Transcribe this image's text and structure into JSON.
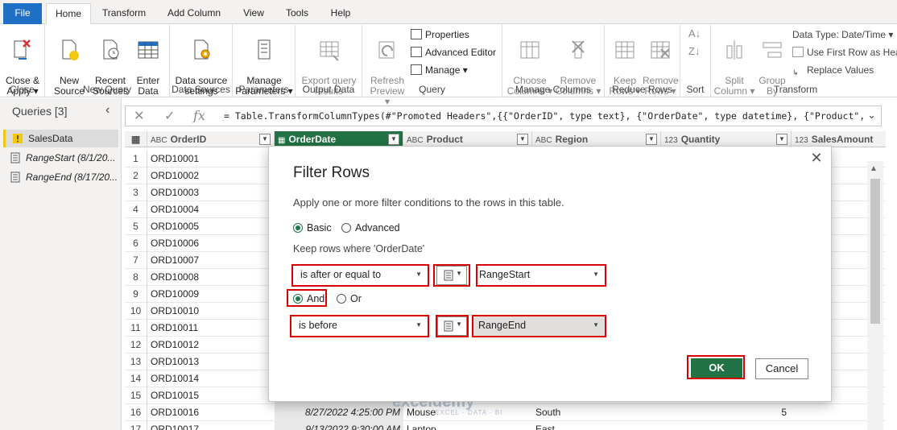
{
  "tabs": [
    "File",
    "Home",
    "Transform",
    "Add Column",
    "View",
    "Tools",
    "Help"
  ],
  "ribbon": {
    "close": {
      "btn": "Close &\nApply ▾",
      "label": "Close"
    },
    "new_query": {
      "new_source": "New\nSource ▾",
      "recent_sources": "Recent\nSources ▾",
      "enter_data": "Enter\nData",
      "label": "New Query"
    },
    "data_sources": {
      "btn": "Data source\nsettings",
      "label": "Data Sources"
    },
    "parameters": {
      "btn": "Manage\nParameters ▾",
      "label": "Parameters"
    },
    "output_data": {
      "btn": "Export query\nresults",
      "label": "Output Data"
    },
    "query": {
      "refresh": "Refresh\nPreview ▾",
      "properties": "Properties",
      "advanced_editor": "Advanced Editor",
      "manage": "Manage ▾",
      "label": "Query"
    },
    "manage_columns": {
      "choose": "Choose\nColumns ▾",
      "remove": "Remove\nColumns ▾",
      "label": "Manage Columns"
    },
    "reduce_rows": {
      "keep": "Keep\nRows ▾",
      "remove": "Remove\nRows ▾",
      "label": "Reduce Rows"
    },
    "sort": {
      "label": "Sort"
    },
    "transform": {
      "split": "Split\nColumn ▾",
      "group": "Group\nBy",
      "data_type": "Data Type: Date/Time ▾",
      "use_first_row": "Use First Row as Headers ▾",
      "replace_values": "Replace Values",
      "label": "Transform"
    }
  },
  "queries": {
    "header": "Queries [3]",
    "items": [
      {
        "name": "SalesData"
      },
      {
        "name": "RangeStart (8/1/20..."
      },
      {
        "name": "RangeEnd (8/17/20..."
      }
    ]
  },
  "formula": "= Table.TransformColumnTypes(#\"Promoted Headers\",{{\"OrderID\", type text}, {\"OrderDate\", type datetime}, {\"Product\",",
  "grid": {
    "columns": [
      {
        "type": "ABC",
        "name": "OrderID"
      },
      {
        "type": "▦",
        "name": "OrderDate"
      },
      {
        "type": "ABC",
        "name": "Product"
      },
      {
        "type": "ABC",
        "name": "Region"
      },
      {
        "type": "123",
        "name": "Quantity"
      },
      {
        "type": "123",
        "name": "SalesAmount"
      }
    ],
    "rows": [
      {
        "n": "1",
        "id": "ORD10001"
      },
      {
        "n": "2",
        "id": "ORD10002"
      },
      {
        "n": "3",
        "id": "ORD10003"
      },
      {
        "n": "4",
        "id": "ORD10004"
      },
      {
        "n": "5",
        "id": "ORD10005"
      },
      {
        "n": "6",
        "id": "ORD10006"
      },
      {
        "n": "7",
        "id": "ORD10007"
      },
      {
        "n": "8",
        "id": "ORD10008"
      },
      {
        "n": "9",
        "id": "ORD10009"
      },
      {
        "n": "10",
        "id": "ORD10010"
      },
      {
        "n": "11",
        "id": "ORD10011"
      },
      {
        "n": "12",
        "id": "ORD10012"
      },
      {
        "n": "13",
        "id": "ORD10013"
      },
      {
        "n": "14",
        "id": "ORD10014"
      },
      {
        "n": "15",
        "id": "ORD10015"
      },
      {
        "n": "16",
        "id": "ORD10016",
        "date": "8/27/2022 4:25:00 PM",
        "product": "Mouse",
        "region": "South",
        "qty": "5"
      },
      {
        "n": "17",
        "id": "ORD10017",
        "date": "9/13/2022 9:30:00 AM",
        "product": "Laptop",
        "region": "East"
      }
    ]
  },
  "dialog": {
    "title": "Filter Rows",
    "description": "Apply one or more filter conditions to the rows in this table.",
    "basic": "Basic",
    "advanced": "Advanced",
    "keep_rows": "Keep rows where 'OrderDate'",
    "condition1": {
      "operator": "is after or equal to",
      "value": "RangeStart"
    },
    "and": "And",
    "or": "Or",
    "condition2": {
      "operator": "is before",
      "value": "RangeEnd"
    },
    "ok": "OK",
    "cancel": "Cancel",
    "close": "✕"
  },
  "watermark": {
    "brand": "exceldemy",
    "tagline": "EXCEL · DATA · BI"
  },
  "colors": {
    "accent": "#217346",
    "highlight": "#d80000",
    "file_tab": "#1f6fc5"
  }
}
